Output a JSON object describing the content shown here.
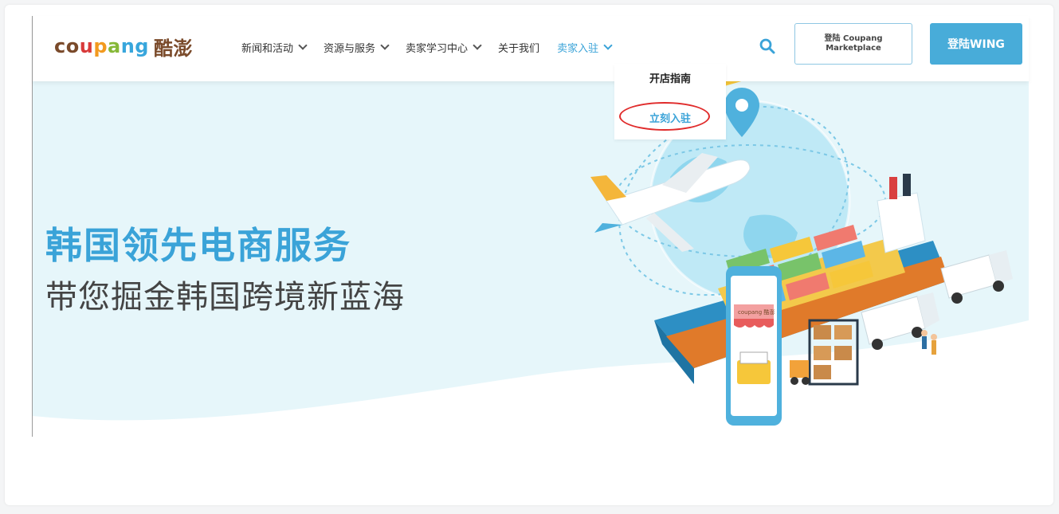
{
  "logo": {
    "latin_parts": [
      "co",
      "u",
      "p",
      "a",
      "ng"
    ],
    "cn": "酷澎"
  },
  "nav": {
    "items": [
      {
        "label": "新闻和活动",
        "has_dropdown": true
      },
      {
        "label": "资源与服务",
        "has_dropdown": true
      },
      {
        "label": "卖家学习中心",
        "has_dropdown": true
      },
      {
        "label": "关于我们",
        "has_dropdown": false
      },
      {
        "label": "卖家入驻",
        "has_dropdown": true,
        "active": true
      }
    ]
  },
  "header": {
    "search_icon": "search-icon",
    "marketplace_button": {
      "line1": "登陆 Coupang",
      "line2": "Marketplace"
    },
    "wing_button": "登陆WING"
  },
  "dropdown": {
    "items": [
      "开店指南",
      "立刻入驻"
    ],
    "highlight_color": "#e02b2b"
  },
  "hero": {
    "title": "韩国领先电商服务",
    "subtitle": "带您掘金韩国跨境新蓝海",
    "illustration_badge": "coupang 酷澎"
  },
  "colors": {
    "accent": "#3aa3d8",
    "hero_bg": "#e6f6fa",
    "wing_button": "#48acd9",
    "logo_brown": "#7a4a2a"
  }
}
